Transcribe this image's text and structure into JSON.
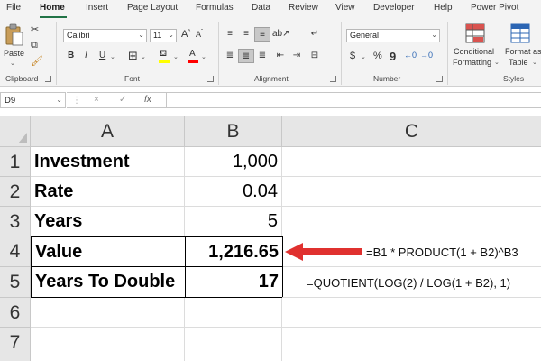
{
  "menu": {
    "tabs": [
      "File",
      "Home",
      "Insert",
      "Page Layout",
      "Formulas",
      "Data",
      "Review",
      "View",
      "Developer",
      "Help",
      "Power Pivot"
    ],
    "active_tab": "Home"
  },
  "ribbon": {
    "clipboard": {
      "paste_label": "Paste",
      "group_label": "Clipboard"
    },
    "font": {
      "font_name": "Calibri",
      "font_size": "11",
      "bold": "B",
      "italic": "I",
      "underline": "U",
      "grow": "A",
      "shrink": "A",
      "group_label": "Font",
      "fill_color": "#ffff00",
      "font_color": "#ff0000"
    },
    "alignment": {
      "group_label": "Alignment"
    },
    "number": {
      "format": "General",
      "currency": "$",
      "percent": "%",
      "comma": "9",
      "group_label": "Number"
    },
    "styles": {
      "conditional_line1": "Conditional",
      "conditional_line2": "Formatting",
      "format_line1": "Format as",
      "format_line2": "Table",
      "group_label": "Styles"
    }
  },
  "formula_bar": {
    "name_box": "D9",
    "cancel_icon": "×",
    "enter_icon": "✓",
    "fx": "fx",
    "formula": ""
  },
  "sheet": {
    "columns": [
      "A",
      "B",
      "C"
    ],
    "rows": [
      "1",
      "2",
      "3",
      "4",
      "5",
      "6",
      "7"
    ],
    "cells": [
      {
        "label": "Investment",
        "value": "1,000"
      },
      {
        "label": "Rate",
        "value": "0.04"
      },
      {
        "label": "Years",
        "value": "5"
      },
      {
        "label": "Value",
        "value": "1,216.65"
      },
      {
        "label": "Years To Double",
        "value": "17"
      }
    ],
    "notes": {
      "row4": "=B1 * PRODUCT(1 + B2)^B3",
      "row5": "=QUOTIENT(LOG(2) / LOG(1 + B2), 1)"
    },
    "arrow_color": "#e0312f"
  }
}
